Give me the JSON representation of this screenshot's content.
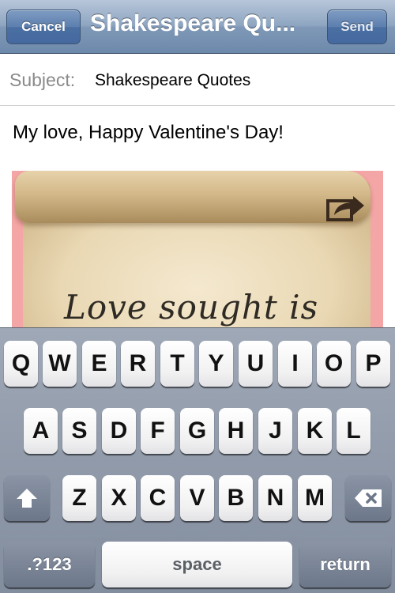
{
  "nav": {
    "cancel_label": "Cancel",
    "title": "Shakespeare Qu...",
    "send_label": "Send"
  },
  "subject": {
    "label": "Subject:",
    "value": "Shakespeare Quotes"
  },
  "body": {
    "text": "My love, Happy Valentine's Day!",
    "image_text": "Love sought is"
  },
  "keyboard": {
    "row1": [
      "Q",
      "W",
      "E",
      "R",
      "T",
      "Y",
      "U",
      "I",
      "O",
      "P"
    ],
    "row2": [
      "A",
      "S",
      "D",
      "F",
      "G",
      "H",
      "J",
      "K",
      "L"
    ],
    "row3": [
      "Z",
      "X",
      "C",
      "V",
      "B",
      "N",
      "M"
    ],
    "numbers_label": ".?123",
    "space_label": "space",
    "return_label": "return"
  },
  "colors": {
    "navbar": "#7f98b7",
    "image_border": "#f4a5a5",
    "keyboard_bg": "#828d9e"
  }
}
